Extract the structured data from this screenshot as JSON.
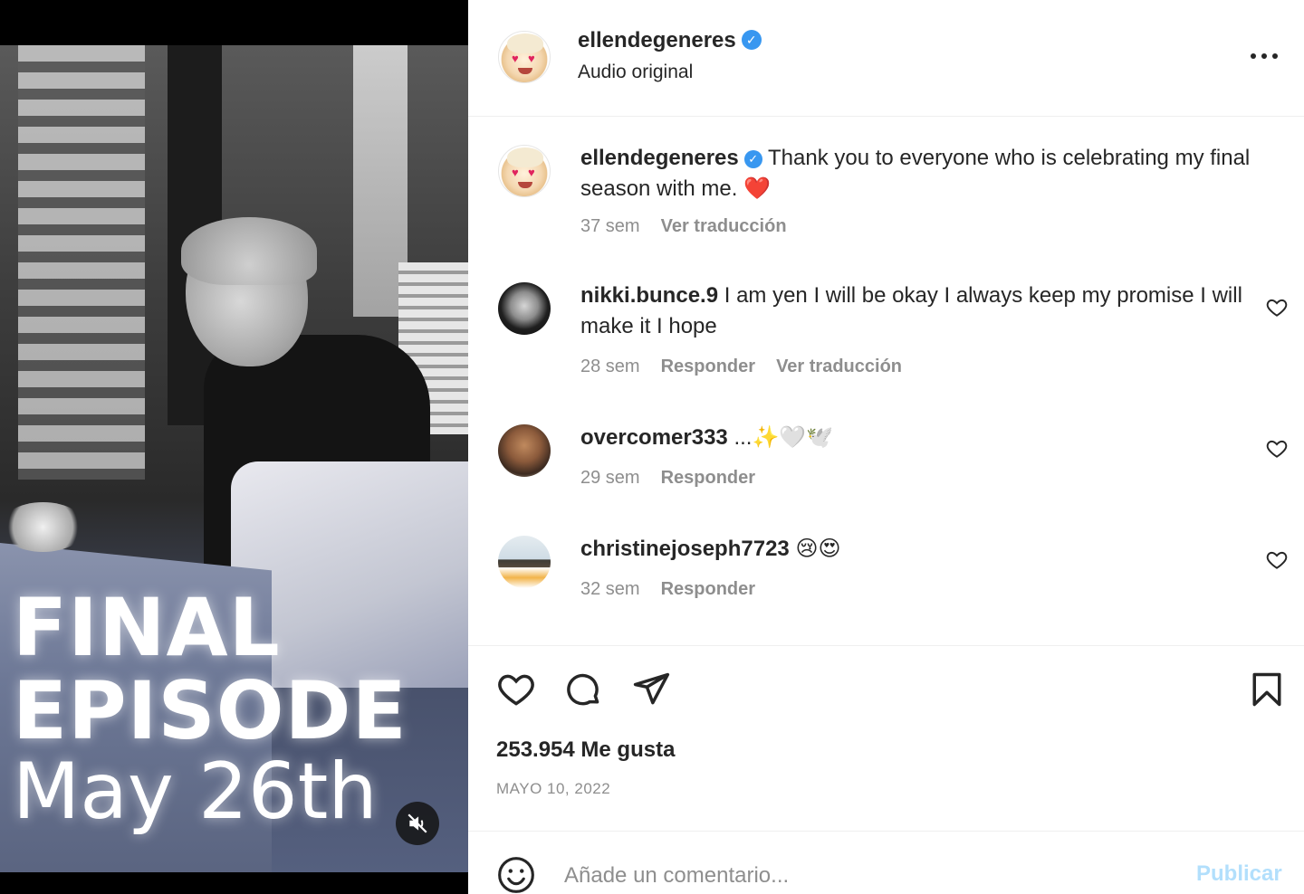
{
  "media": {
    "overlay_line1": "FINAL",
    "overlay_line2": "EPISODE",
    "overlay_date": "May 26th"
  },
  "header": {
    "username": "ellendegeneres",
    "verified": true,
    "subtitle": "Audio original"
  },
  "caption": {
    "username": "ellendegeneres",
    "text": "Thank you to everyone who is celebrating my final season with me.",
    "emoji": "❤️",
    "time": "37 sem",
    "translate_label": "Ver traducción"
  },
  "comments": [
    {
      "username": "nikki.bunce.9",
      "text": "I am yen I will be okay I always keep my promise I will make it I hope",
      "time": "28 sem",
      "reply_label": "Responder",
      "translate_label": "Ver traducción"
    },
    {
      "username": "overcomer333",
      "text": "...✨🤍🕊️",
      "time": "29 sem",
      "reply_label": "Responder"
    },
    {
      "username": "christinejoseph7723",
      "text": "😢😍",
      "time": "32 sem",
      "reply_label": "Responder"
    }
  ],
  "stats": {
    "likes": "253.954 Me gusta",
    "date": "MAYO 10, 2022"
  },
  "composer": {
    "placeholder": "Añade un comentario...",
    "publish_label": "Publicar"
  },
  "colors": {
    "verified": "#3897f0",
    "muted_text": "#8e8e8e",
    "publish_disabled": "#b2dffc",
    "heart_emoji": "#e0245e"
  }
}
